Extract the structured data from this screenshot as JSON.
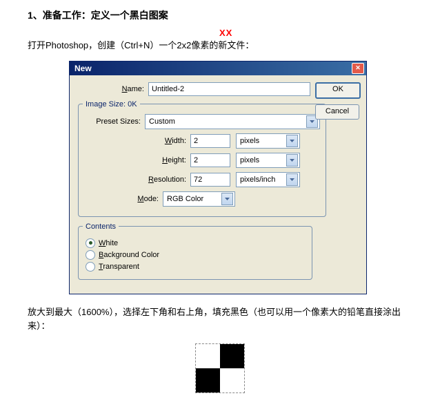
{
  "doc": {
    "heading": "1、准备工作：定义一个黑白图案",
    "red_mark": "XX",
    "intro": "打开Photoshop，创建（Ctrl+N）一个2x2像素的新文件：",
    "post": "放大到最大（1600%），选择左下角和右上角，填充黑色（也可以用一个像素大的铅笔直接涂出来）："
  },
  "dialog": {
    "title": "New",
    "buttons": {
      "ok": "OK",
      "cancel": "Cancel"
    },
    "name_label": "Name:",
    "name_value": "Untitled-2",
    "image_size": {
      "legend": "Image Size: 0K",
      "preset_label": "Preset Sizes:",
      "preset_value": "Custom",
      "width_label": "Width:",
      "width_value": "2",
      "width_unit": "pixels",
      "height_label": "Height:",
      "height_value": "2",
      "height_unit": "pixels",
      "resolution_label": "Resolution:",
      "resolution_value": "72",
      "resolution_unit": "pixels/inch",
      "mode_label": "Mode:",
      "mode_value": "RGB Color"
    },
    "contents": {
      "legend": "Contents",
      "white": "White",
      "bg": "Background Color",
      "transparent": "Transparent"
    }
  }
}
